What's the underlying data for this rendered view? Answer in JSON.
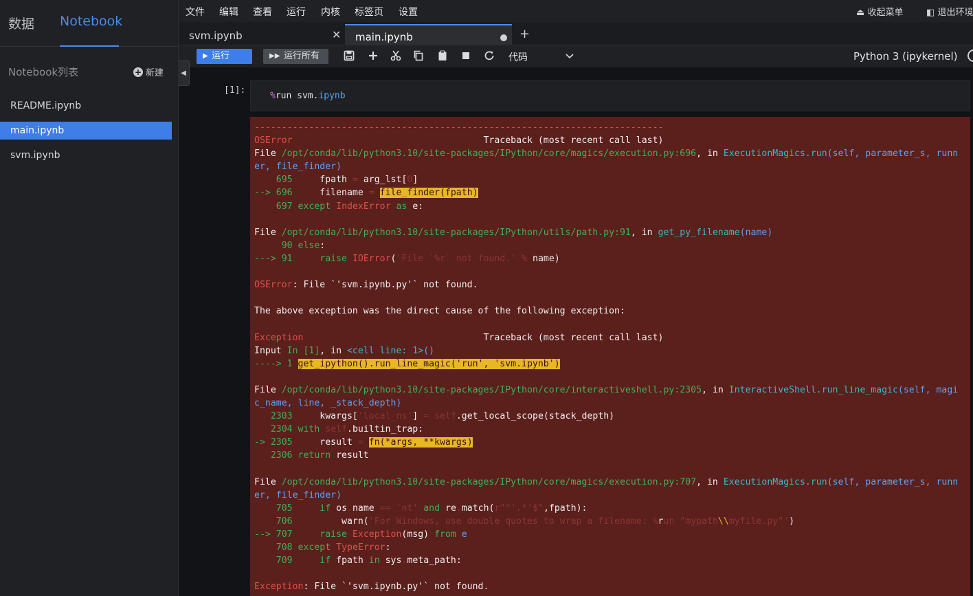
{
  "sidebar": {
    "tabs": [
      "数据",
      "Notebook"
    ],
    "active_tab": "Notebook",
    "list_title": "Notebook列表",
    "new_label": "新建",
    "files": [
      "README.ipynb",
      "main.ipynb",
      "svm.ipynb"
    ],
    "active_file": "main.ipynb"
  },
  "menubar": {
    "items": [
      "文件",
      "编辑",
      "查看",
      "运行",
      "内核",
      "标签页",
      "设置"
    ],
    "collapse_label": "收起菜单",
    "exit_label": "退出环境"
  },
  "tabs": [
    {
      "label": "svm.ipynb",
      "state": "close"
    },
    {
      "label": "main.ipynb",
      "state": "unsaved"
    }
  ],
  "toolbar": {
    "run_label": "运行",
    "run_all_label": "运行所有",
    "cell_type": "代码",
    "kernel": "Python 3 (ipykernel)",
    "icons": [
      "save-icon",
      "add-icon",
      "cut-icon",
      "copy-icon",
      "paste-icon",
      "stop-icon",
      "restart-icon"
    ]
  },
  "cell": {
    "prompt": "[1]:",
    "code_magic": "%",
    "code_cmd": "run svm.",
    "code_ext": "ipynb"
  },
  "colors": {
    "accent": "#4d8af0",
    "error_bg": "#5b1f1c",
    "highlight": "#e8b724"
  },
  "output": {
    "lines": [
      [
        [
          "---------------------------------------------------------------------------",
          "red"
        ]
      ],
      [
        [
          "OSError",
          "red"
        ],
        [
          "                                   Traceback (most recent call last)",
          ""
        ]
      ],
      [
        [
          "File ",
          ""
        ],
        [
          "/opt/conda/lib/python3.10/site-packages/IPython/core/magics/execution.py:696",
          "green"
        ],
        [
          ", in ",
          ""
        ],
        [
          "ExecutionMagics.run",
          "cyan"
        ],
        [
          "(self, parameter_s, runn",
          "blue"
        ]
      ],
      [
        [
          "er, file_finder)",
          "blue"
        ]
      ],
      [
        [
          "    695 ",
          "green"
        ],
        [
          "    fpath ",
          ""
        ],
        [
          "=",
          "dim"
        ],
        [
          " arg_lst[",
          ""
        ],
        [
          "0",
          "dim"
        ],
        [
          "]",
          ""
        ]
      ],
      [
        [
          "--> 696 ",
          "green"
        ],
        [
          "    filename ",
          ""
        ],
        [
          "=",
          "dim"
        ],
        [
          " ",
          ""
        ],
        [
          "file_finder(fpath)",
          "hl"
        ]
      ],
      [
        [
          "    697 ",
          "green"
        ],
        [
          "except",
          "kw"
        ],
        [
          " ",
          ""
        ],
        [
          "IndexError",
          "red"
        ],
        [
          " ",
          ""
        ],
        [
          "as",
          "kw"
        ],
        [
          " e:",
          ""
        ]
      ],
      [
        [
          "",
          ""
        ]
      ],
      [
        [
          "File ",
          ""
        ],
        [
          "/opt/conda/lib/python3.10/site-packages/IPython/utils/path.py:91",
          "green"
        ],
        [
          ", in ",
          ""
        ],
        [
          "get_py_filename",
          "cyan"
        ],
        [
          "(name)",
          "blue"
        ]
      ],
      [
        [
          "     90 ",
          "green"
        ],
        [
          "else",
          "kw"
        ],
        [
          ":",
          ""
        ]
      ],
      [
        [
          "---> 91 ",
          "green"
        ],
        [
          "    ",
          ""
        ],
        [
          "raise",
          "kw"
        ],
        [
          " ",
          ""
        ],
        [
          "IOError",
          "red"
        ],
        [
          "(",
          ""
        ],
        [
          "'File `%r` not found.'",
          "dim"
        ],
        [
          " ",
          ""
        ],
        [
          "%",
          "dim"
        ],
        [
          " name)",
          ""
        ]
      ],
      [
        [
          "",
          ""
        ]
      ],
      [
        [
          "OSError",
          "red"
        ],
        [
          ": File `'svm.ipynb.py'` not found.",
          ""
        ]
      ],
      [
        [
          "",
          ""
        ]
      ],
      [
        [
          "The above exception was the direct cause of the following exception:",
          ""
        ]
      ],
      [
        [
          "",
          ""
        ]
      ],
      [
        [
          "Exception",
          "red"
        ],
        [
          "                                 Traceback (most recent call last)",
          ""
        ]
      ],
      [
        [
          "Input ",
          ""
        ],
        [
          "In [1]",
          "green"
        ],
        [
          ", in ",
          ""
        ],
        [
          "<cell line: 1>",
          "cyan"
        ],
        [
          "()",
          "blue"
        ]
      ],
      [
        [
          "----> 1 ",
          "green"
        ],
        [
          "get_ipython().run_line_magic('run', 'svm.ipynb')",
          "hl"
        ]
      ],
      [
        [
          "",
          ""
        ]
      ],
      [
        [
          "File ",
          ""
        ],
        [
          "/opt/conda/lib/python3.10/site-packages/IPython/core/interactiveshell.py:2305",
          "green"
        ],
        [
          ", in ",
          ""
        ],
        [
          "InteractiveShell.run_line_magic",
          "cyan"
        ],
        [
          "(self, magi",
          "blue"
        ]
      ],
      [
        [
          "c_name, line, _stack_depth)",
          "blue"
        ]
      ],
      [
        [
          "   2303 ",
          "green"
        ],
        [
          "    kwargs[",
          ""
        ],
        [
          "'local_ns'",
          "dim"
        ],
        [
          "] ",
          ""
        ],
        [
          "=",
          "dim"
        ],
        [
          " ",
          ""
        ],
        [
          "self",
          "dim"
        ],
        [
          ".",
          ""
        ],
        [
          "get_local_scope(stack_depth)",
          ""
        ]
      ],
      [
        [
          "   2304 ",
          "green"
        ],
        [
          "with",
          "kw"
        ],
        [
          " ",
          ""
        ],
        [
          "self",
          "dim"
        ],
        [
          ".builtin_trap:",
          ""
        ]
      ],
      [
        [
          "-> 2305 ",
          "green"
        ],
        [
          "    result ",
          ""
        ],
        [
          "=",
          "dim"
        ],
        [
          " ",
          ""
        ],
        [
          "fn(*args, **kwargs)",
          "hl"
        ]
      ],
      [
        [
          "   2306 ",
          "green"
        ],
        [
          "return",
          "kw"
        ],
        [
          " result",
          ""
        ]
      ],
      [
        [
          "",
          ""
        ]
      ],
      [
        [
          "File ",
          ""
        ],
        [
          "/opt/conda/lib/python3.10/site-packages/IPython/core/magics/execution.py:707",
          "green"
        ],
        [
          ", in ",
          ""
        ],
        [
          "ExecutionMagics.run",
          "cyan"
        ],
        [
          "(self, parameter_s, runn",
          "blue"
        ]
      ],
      [
        [
          "er, file_finder)",
          "blue"
        ]
      ],
      [
        [
          "    705 ",
          "green"
        ],
        [
          "    ",
          ""
        ],
        [
          "if",
          "kw"
        ],
        [
          " os",
          ""
        ],
        [
          ".",
          "dim"
        ],
        [
          "name ",
          ""
        ],
        [
          "==",
          "dim"
        ],
        [
          " ",
          ""
        ],
        [
          "'nt'",
          "dim"
        ],
        [
          " ",
          ""
        ],
        [
          "and",
          "kw"
        ],
        [
          " re",
          ""
        ],
        [
          ".",
          "dim"
        ],
        [
          "match(",
          ""
        ],
        [
          "r\"^'.*'$\"",
          "dim"
        ],
        [
          ",fpath):",
          ""
        ]
      ],
      [
        [
          "    706 ",
          "green"
        ],
        [
          "        warn(",
          ""
        ],
        [
          "'For Windows, use double quotes to wrap a filename: %",
          "dim"
        ],
        [
          "r",
          ""
        ],
        [
          "un \"mypath",
          "dim"
        ],
        [
          "\\\\",
          "yellow"
        ],
        [
          "myfile.py\"'",
          "dim"
        ],
        [
          ")",
          ""
        ]
      ],
      [
        [
          "--> 707 ",
          "green"
        ],
        [
          "    ",
          ""
        ],
        [
          "raise",
          "kw"
        ],
        [
          " ",
          ""
        ],
        [
          "Exception",
          "red"
        ],
        [
          "(msg) ",
          ""
        ],
        [
          "from",
          "kw"
        ],
        [
          " ",
          ""
        ],
        [
          "e",
          "blue"
        ]
      ],
      [
        [
          "    708 ",
          "green"
        ],
        [
          "except",
          "kw"
        ],
        [
          " ",
          ""
        ],
        [
          "TypeError",
          "red"
        ],
        [
          ":",
          ""
        ]
      ],
      [
        [
          "    709 ",
          "green"
        ],
        [
          "    ",
          ""
        ],
        [
          "if",
          "kw"
        ],
        [
          " fpath ",
          ""
        ],
        [
          "in",
          "kw"
        ],
        [
          " sys",
          ""
        ],
        [
          ".",
          "dim"
        ],
        [
          "meta_path:",
          ""
        ]
      ],
      [
        [
          "",
          ""
        ]
      ],
      [
        [
          "Exception",
          "red"
        ],
        [
          ": File `'svm.ipynb.py'` not found.",
          ""
        ]
      ]
    ]
  }
}
